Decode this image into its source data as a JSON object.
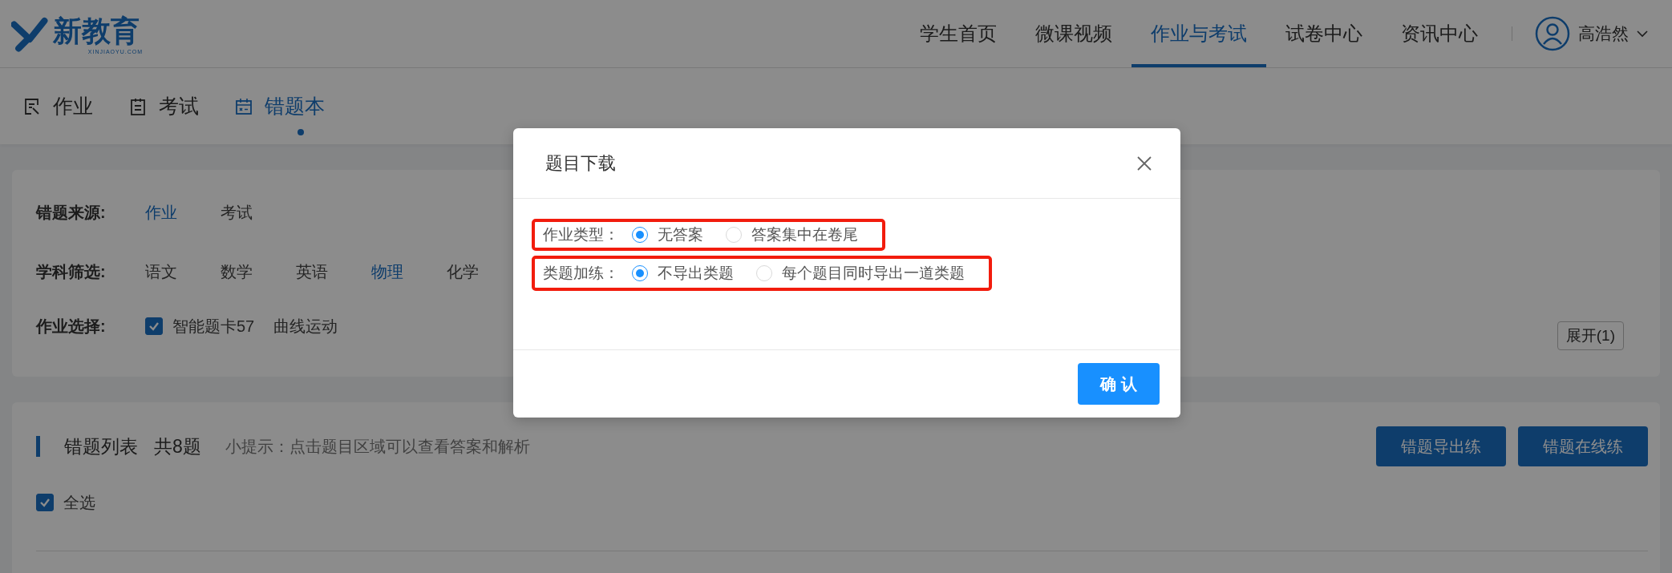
{
  "header": {
    "logo": {
      "name": "新教育",
      "subtext": "XINJIAOYU.COM"
    },
    "nav": [
      {
        "label": "学生首页",
        "selected": false
      },
      {
        "label": "微课视频",
        "selected": false
      },
      {
        "label": "作业与考试",
        "selected": true
      },
      {
        "label": "试卷中心",
        "selected": false
      },
      {
        "label": "资讯中心",
        "selected": false
      }
    ],
    "user": {
      "name": "高浩然"
    }
  },
  "subtabs": [
    {
      "label": "作业",
      "kind": "homework",
      "selected": false
    },
    {
      "label": "考试",
      "kind": "exam",
      "selected": false
    },
    {
      "label": "错题本",
      "kind": "mistakes",
      "selected": true
    }
  ],
  "filters": {
    "source": {
      "label": "错题来源:",
      "options": [
        {
          "label": "作业",
          "selected": true
        },
        {
          "label": "考试",
          "selected": false
        }
      ]
    },
    "subject": {
      "label": "学科筛选:",
      "options": [
        {
          "label": "语文",
          "selected": false
        },
        {
          "label": "数学",
          "selected": false
        },
        {
          "label": "英语",
          "selected": false
        },
        {
          "label": "物理",
          "selected": true
        },
        {
          "label": "化学",
          "selected": false
        }
      ]
    },
    "homework": {
      "label": "作业选择:",
      "items": [
        {
          "title": "智能题卡57",
          "chapter": "曲线运动",
          "checked": true
        }
      ]
    },
    "expand_button": "展开(1)"
  },
  "mistake_list": {
    "title": "错题列表",
    "count": "共8题",
    "hint": "小提示：点击题目区域可以查看答案和解析",
    "buttons": [
      "错题导出练",
      "错题在线练"
    ],
    "select_all": {
      "label": "全选",
      "checked": true
    }
  },
  "dialog": {
    "title": "题目下载",
    "rows": [
      {
        "label": "作业类型：",
        "choices": [
          {
            "label": "无答案",
            "selected": true
          },
          {
            "label": "答案集中在卷尾",
            "selected": false
          }
        ]
      },
      {
        "label": "类题加练：",
        "choices": [
          {
            "label": "不导出类题",
            "selected": true
          },
          {
            "label": "每个题目同时导出一道类题",
            "selected": false
          }
        ]
      }
    ],
    "confirm": "确 认"
  }
}
